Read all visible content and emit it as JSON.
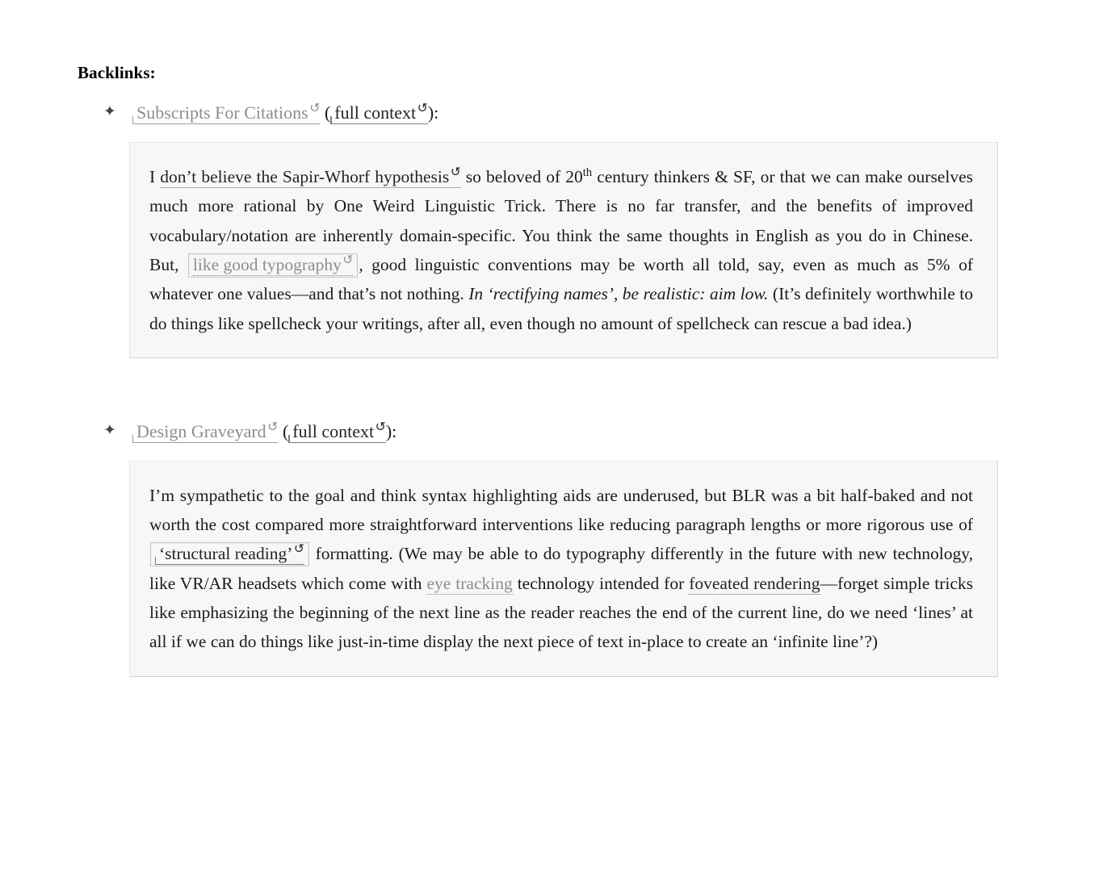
{
  "heading": "Backlinks:",
  "icons": {
    "star_bullet": "✦",
    "reload": "↺"
  },
  "backlinks": [
    {
      "title": "Subscripts For Citations",
      "title_icon": "reload-icon",
      "context_label": "full context",
      "context_icon": "reload-icon",
      "open_paren": " (",
      "close_paren": "):",
      "quote": {
        "seg_1_text": "I ",
        "link_1": "don’t believe the Sapir-Whorf hypothesis",
        "seg_2_text": " so beloved of 20",
        "sup_1": "th",
        "seg_3_text": " century thinkers & SF, or that we can make ourselves much more rational by One Weird Linguistic Trick. There is no far transfer, and the benefits of improved vocabulary/notation are inherently domain-specific. You think the same thoughts in English as you do in Chinese. But, ",
        "boxed_link": "like good typography",
        "seg_4_text": ", good linguistic conventions may be worth all told, say, even as much as 5% of whatever one values—and that’s not nothing. ",
        "italic_1": "In ‘rectifying names’, be realistic: aim low.",
        "seg_5_text": " (It’s definitely worthwhile to do things like spellcheck your writings, after all, even though no amount of spellcheck can rescue a bad idea.)"
      }
    },
    {
      "title": "Design Graveyard",
      "title_icon": "reload-icon",
      "context_label": "full context",
      "context_icon": "reload-icon",
      "open_paren": " (",
      "close_paren": "):",
      "quote": {
        "seg_1_text": "I’m sympathetic to the goal and think syntax highlighting aids are underused, but BLR was a bit half-baked and not worth the cost compared more straightforward interventions like reducing paragraph lengths or more rigorous use of ",
        "boxed_link": "‘structural reading’",
        "seg_2_text": " formatting. (We may be able to do typography differently in the future with new technology, like VR/AR headsets which come with ",
        "link_eye": "eye tracking",
        "seg_3_text": " technology intended for ",
        "link_fov": "foveated rendering",
        "seg_4_text": "—forget simple tricks like emphasizing the beginning of the next line as the reader reaches the end of the current line, do we need ‘lines’ at all if we can do things like just-in-time display the next piece of text in-place to create an ‘infinite line’?)"
      }
    }
  ],
  "colors": {
    "page_bg": "#ffffff",
    "quote_bg": "#f7f7f7",
    "quote_border": "#e0e0e0",
    "text": "#1b1b1b",
    "link_grey": "#8d8d8d",
    "link_dark": "#20252c",
    "box_border": "#c8c8c8"
  }
}
